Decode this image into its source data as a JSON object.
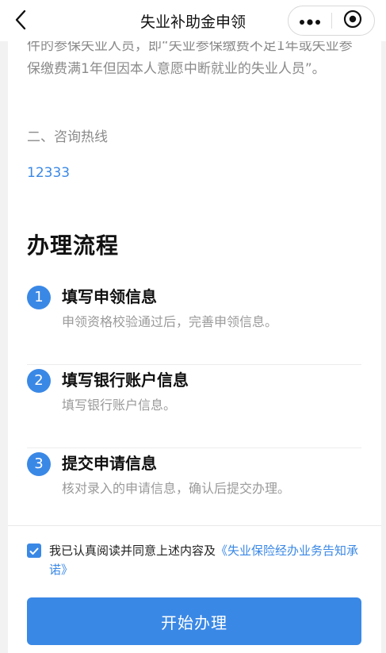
{
  "nav": {
    "title": "失业补助金申领",
    "back_icon": "chevron-left-icon",
    "more_icon": "more-dots-icon",
    "close_icon": "target-circle-icon"
  },
  "notice": {
    "text": "件的参保失业人员，即“失业参保缴费不足1年或失业参保缴费满1年但因本人意愿中断就业的失业人员”。"
  },
  "hotline": {
    "heading": "二、咨询热线",
    "number": "12333"
  },
  "process": {
    "title": "办理流程",
    "steps": [
      {
        "num": "1",
        "title": "填写申领信息",
        "desc": "申领资格校验通过后，完善申领信息。"
      },
      {
        "num": "2",
        "title": "填写银行账户信息",
        "desc": "填写银行账户信息。"
      },
      {
        "num": "3",
        "title": "提交申请信息",
        "desc": "核对录入的申请信息，确认后提交办理。"
      }
    ]
  },
  "agreement": {
    "checked": true,
    "text": "我已认真阅读并同意上述内容及",
    "link": "《失业保险经办业务告知承诺》"
  },
  "action": {
    "start_label": "开始办理"
  },
  "colors": {
    "accent": "#3a88e6",
    "muted_text": "#8a8a8a"
  }
}
